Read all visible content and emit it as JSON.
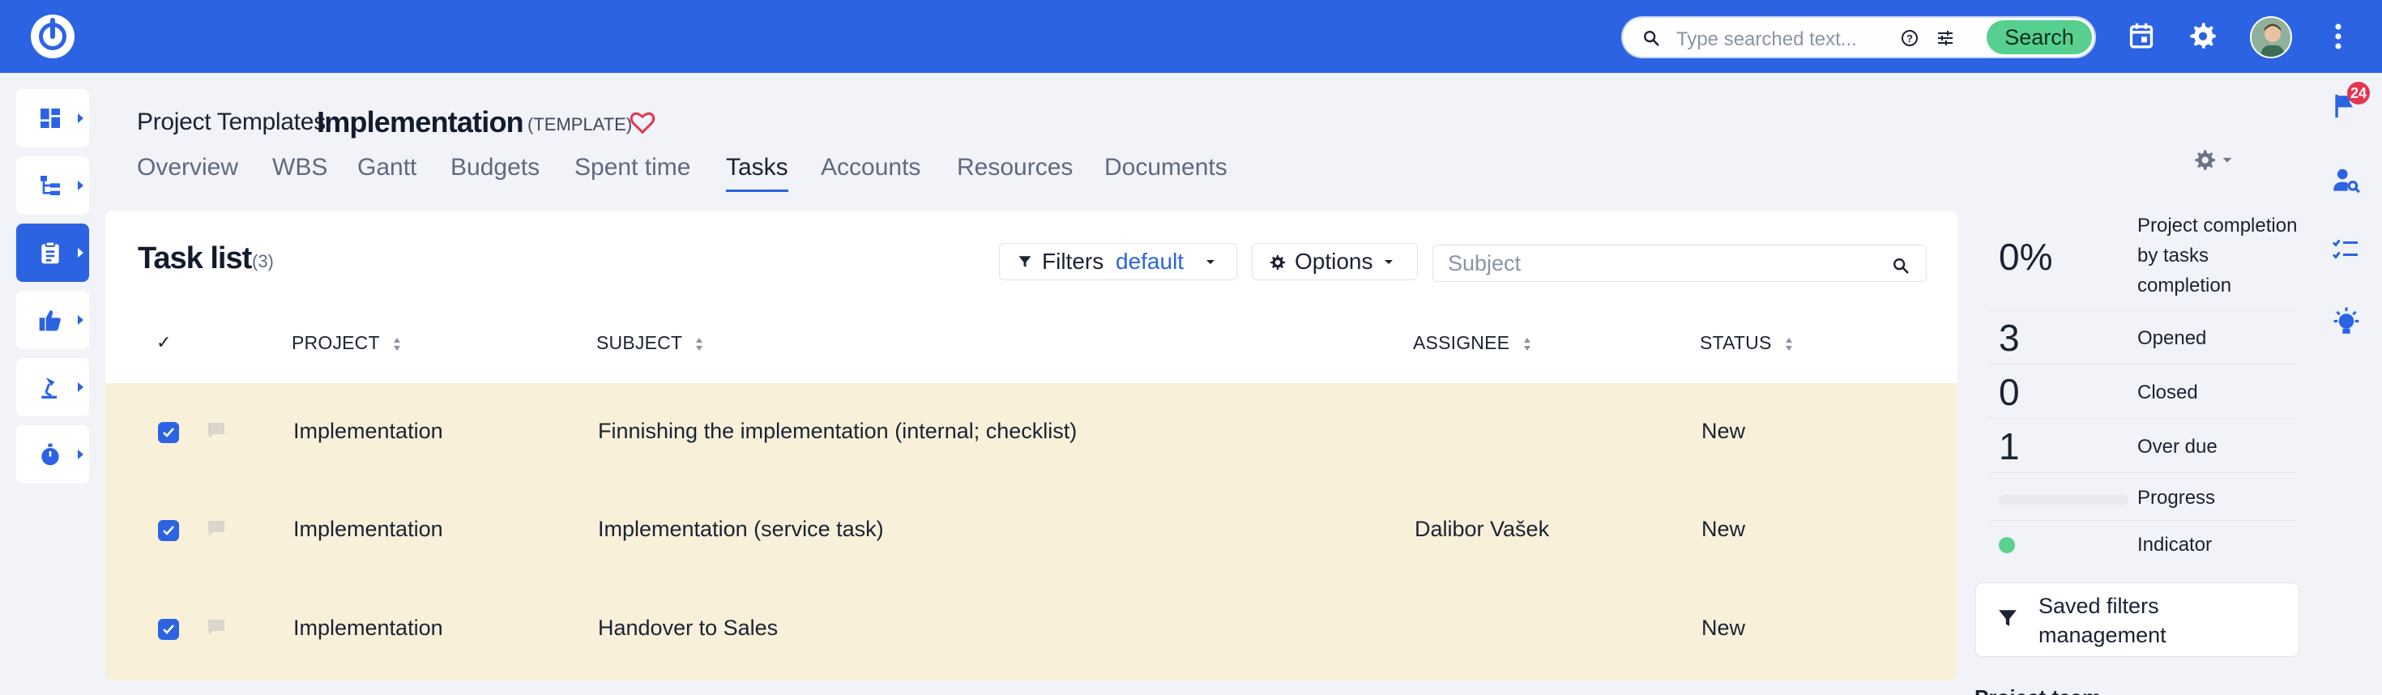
{
  "search": {
    "placeholder": "Type searched text...",
    "button_label": "Search"
  },
  "header": {
    "breadcrumb": "Project Templates",
    "title": "Implementation",
    "template_tag": "(TEMPLATE)"
  },
  "tabs": [
    {
      "label": "Overview"
    },
    {
      "label": "WBS"
    },
    {
      "label": "Gantt"
    },
    {
      "label": "Budgets"
    },
    {
      "label": "Spent time"
    },
    {
      "label": "Tasks"
    },
    {
      "label": "Accounts"
    },
    {
      "label": "Resources"
    },
    {
      "label": "Documents"
    }
  ],
  "active_tab": "Tasks",
  "task_list": {
    "title": "Task list",
    "count": "(3)",
    "filters_label": "Filters",
    "filters_value": "default",
    "options_label": "Options",
    "subject_placeholder": "Subject",
    "check_header": "✓",
    "columns": [
      "PROJECT",
      "SUBJECT",
      "ASSIGNEE",
      "STATUS"
    ],
    "rows": [
      {
        "project": "Implementation",
        "subject": "Finnishing the implementation (internal; checklist)",
        "assignee": "",
        "status": "New",
        "checked": true
      },
      {
        "project": "Implementation",
        "subject": "Implementation (service task)",
        "assignee": "Dalibor Vašek",
        "status": "New",
        "checked": true
      },
      {
        "project": "Implementation",
        "subject": "Handover to Sales",
        "assignee": "",
        "status": "New",
        "checked": true
      }
    ]
  },
  "stats": {
    "completion_value": "0%",
    "completion_label": "Project completion by tasks completion",
    "opened_value": "3",
    "opened_label": "Opened",
    "closed_value": "0",
    "closed_label": "Closed",
    "overdue_value": "1",
    "overdue_label": "Over due",
    "progress_label": "Progress",
    "progress_fraction": 0,
    "indicator_label": "Indicator",
    "indicator_color": "#5ad28f"
  },
  "saved_filters_label": "Saved filters management",
  "project_team_label": "Project team",
  "notifications_count": "24",
  "colors": {
    "brand": "#2b63e3",
    "row_highlight": "#f9f0d9",
    "search_button": "#56cf8f",
    "badge": "#e5364f"
  },
  "icons": {
    "left_nav": [
      "dashboard-icon",
      "tree-icon",
      "clipboard-icon",
      "thumbs-up-icon",
      "lamp-icon",
      "stopwatch-icon"
    ],
    "right_rail": [
      "flag-icon",
      "person-search-icon",
      "checklist-icon",
      "lightbulb-icon"
    ]
  }
}
